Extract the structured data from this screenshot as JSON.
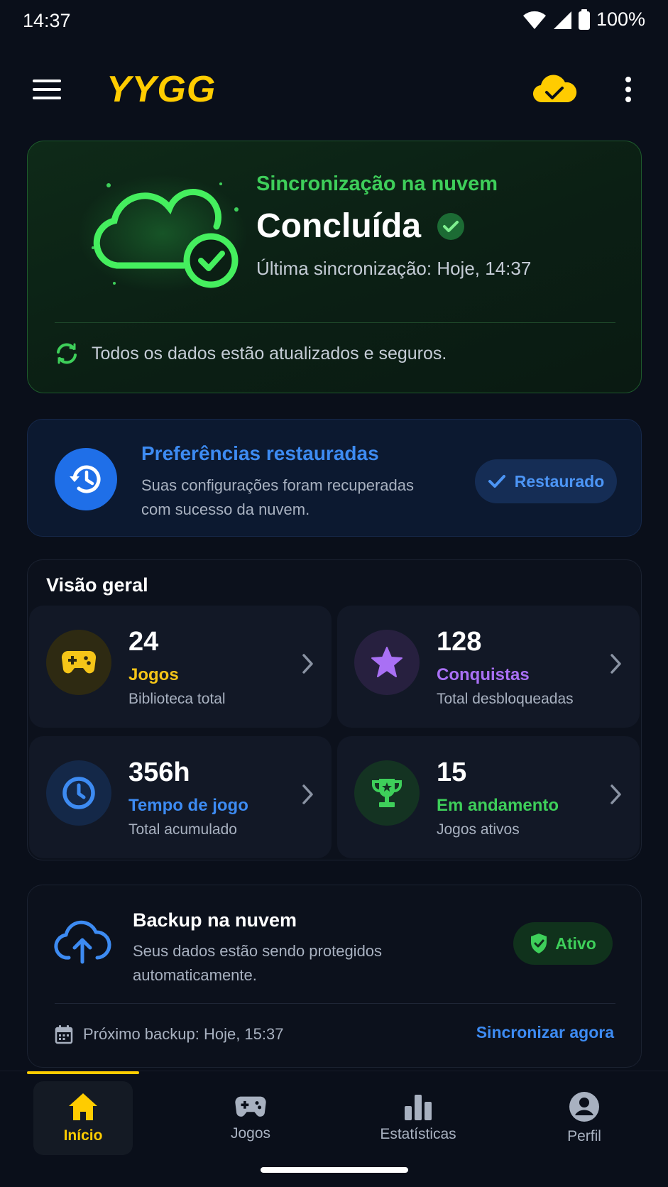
{
  "status_bar": {
    "time": "14:37",
    "battery": "100%"
  },
  "app_bar": {
    "logo": "YYGG"
  },
  "sync_card": {
    "title": "Sincronização na nuvem",
    "status": "Concluída",
    "last_sync": "Última sincronização: Hoje, 14:37",
    "footer": "Todos os dados estão atualizados e seguros."
  },
  "preferences_card": {
    "title": "Preferências restauradas",
    "description": "Suas configurações foram recuperadas com sucesso da nuvem.",
    "badge": "Restaurado"
  },
  "overview": {
    "title": "Visão geral",
    "stats": [
      {
        "value": "24",
        "label": "Jogos",
        "sub": "Biblioteca total",
        "color": "#f5c518",
        "icon": "gamepad-icon"
      },
      {
        "value": "128",
        "label": "Conquistas",
        "sub": "Total desbloqueadas",
        "color": "#a970f5",
        "icon": "star-icon"
      },
      {
        "value": "356h",
        "label": "Tempo de jogo",
        "sub": "Total acumulado",
        "color": "#3d8bf2",
        "icon": "clock-icon"
      },
      {
        "value": "15",
        "label": "Em andamento",
        "sub": "Jogos ativos",
        "color": "#3ecf5a",
        "icon": "trophy-icon"
      }
    ]
  },
  "backup_card": {
    "title": "Backup na nuvem",
    "description": "Seus dados estão sendo protegidos automaticamente.",
    "badge": "Ativo",
    "next_backup": "Próximo backup: Hoje, 15:37",
    "sync_now": "Sincronizar agora"
  },
  "bottom_nav": {
    "items": [
      {
        "label": "Início",
        "icon": "home-icon",
        "active": true
      },
      {
        "label": "Jogos",
        "icon": "gamepad-icon",
        "active": false
      },
      {
        "label": "Estatísticas",
        "icon": "bar-chart-icon",
        "active": false
      },
      {
        "label": "Perfil",
        "icon": "profile-icon",
        "active": false
      }
    ]
  },
  "colors": {
    "accent": "#ffcc00",
    "success": "#3ecf5a",
    "info": "#3d8bf2",
    "purple": "#a970f5",
    "background": "#0a0f1a"
  }
}
